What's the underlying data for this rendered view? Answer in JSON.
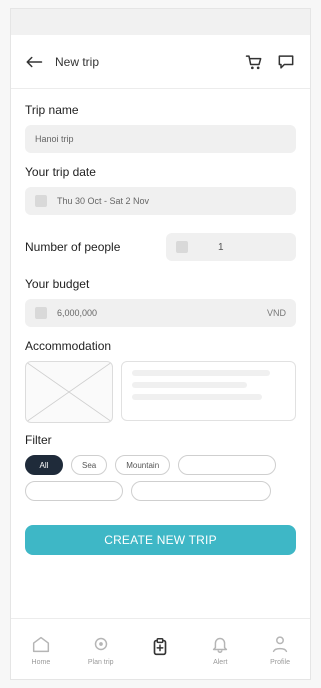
{
  "header": {
    "title": "New trip"
  },
  "form": {
    "trip_name": {
      "label": "Trip name",
      "value": "Hanoi trip"
    },
    "trip_date": {
      "label": "Your trip date",
      "value": "Thu 30 Oct - Sat 2 Nov"
    },
    "people": {
      "label": "Number of people",
      "value": "1"
    },
    "budget": {
      "label": "Your budget",
      "value": "6,000,000",
      "currency": "VND"
    },
    "accommodation": {
      "label": "Accommodation"
    },
    "filter": {
      "label": "Filter",
      "chips": [
        "All",
        "Sea",
        "Mountain"
      ]
    },
    "cta": "CREATE NEW TRIP"
  },
  "bottom_nav": {
    "items": [
      "Home",
      "Plan trip",
      "",
      "Alert",
      "Profile"
    ]
  },
  "colors": {
    "accent": "#3eb7c6",
    "chip_active": "#1f2b3a"
  }
}
